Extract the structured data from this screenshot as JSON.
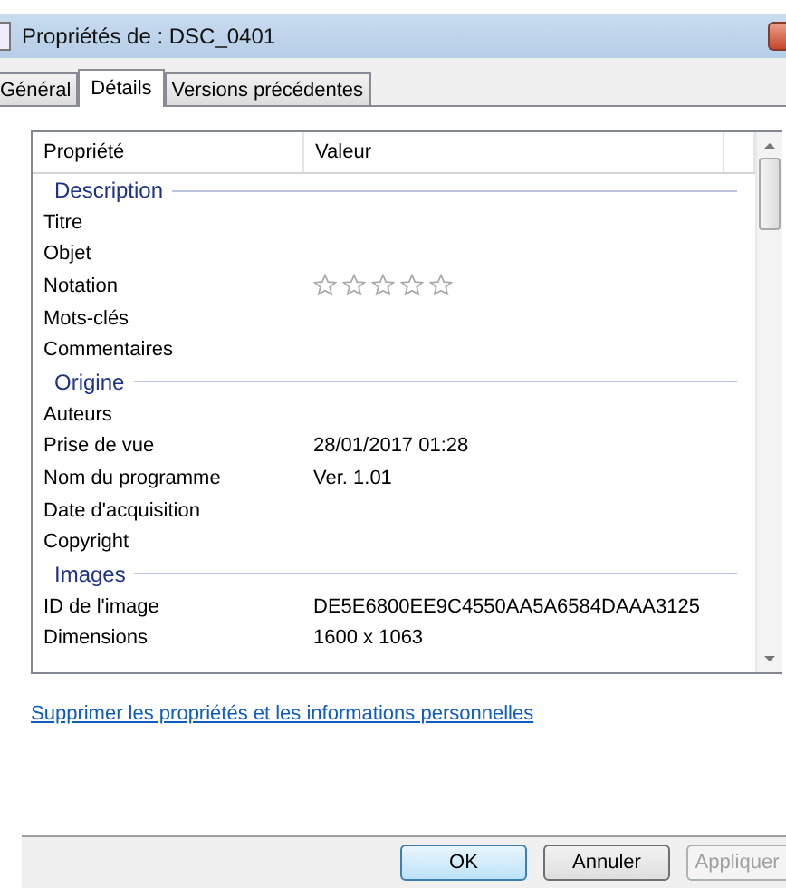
{
  "window": {
    "title": "Propriétés de : DSC_0401"
  },
  "tabs": [
    {
      "label": "Général",
      "selected": false
    },
    {
      "label": "Détails",
      "selected": true
    },
    {
      "label": "Versions précédentes",
      "selected": false
    }
  ],
  "table": {
    "columns": [
      "Propriété",
      "Valeur"
    ],
    "rows": [
      {
        "kind": "section",
        "label": "Description"
      },
      {
        "kind": "text",
        "property": "Titre"
      },
      {
        "kind": "text",
        "property": "Objet"
      },
      {
        "kind": "rating",
        "property": "Notation",
        "stars": 0
      },
      {
        "kind": "text",
        "property": "Mots-clés"
      },
      {
        "kind": "text",
        "property": "Commentaires"
      },
      {
        "kind": "section",
        "label": "Origine"
      },
      {
        "kind": "text",
        "property": "Auteurs"
      },
      {
        "kind": "text",
        "property": "Prise de vue",
        "value": "28/01/2017 01:28"
      },
      {
        "kind": "text",
        "property": "Nom du programme",
        "value": "Ver. 1.01"
      },
      {
        "kind": "text",
        "property": "Date d'acquisition"
      },
      {
        "kind": "text",
        "property": "Copyright"
      },
      {
        "kind": "section",
        "label": "Images"
      },
      {
        "kind": "text",
        "property": "ID de l'image",
        "value": "DE5E6800EE9C4550AA5A6584DAAA3125"
      },
      {
        "kind": "text",
        "property": "Dimensions",
        "value": "1600 x 1063"
      }
    ]
  },
  "link": "Supprimer les propriétés et les informations personnelles",
  "buttons": [
    {
      "label": "OK",
      "disabled": false,
      "default": true
    },
    {
      "label": "Annuler",
      "disabled": false,
      "default": false
    },
    {
      "label": "Appliquer",
      "disabled": true,
      "default": false
    }
  ]
}
